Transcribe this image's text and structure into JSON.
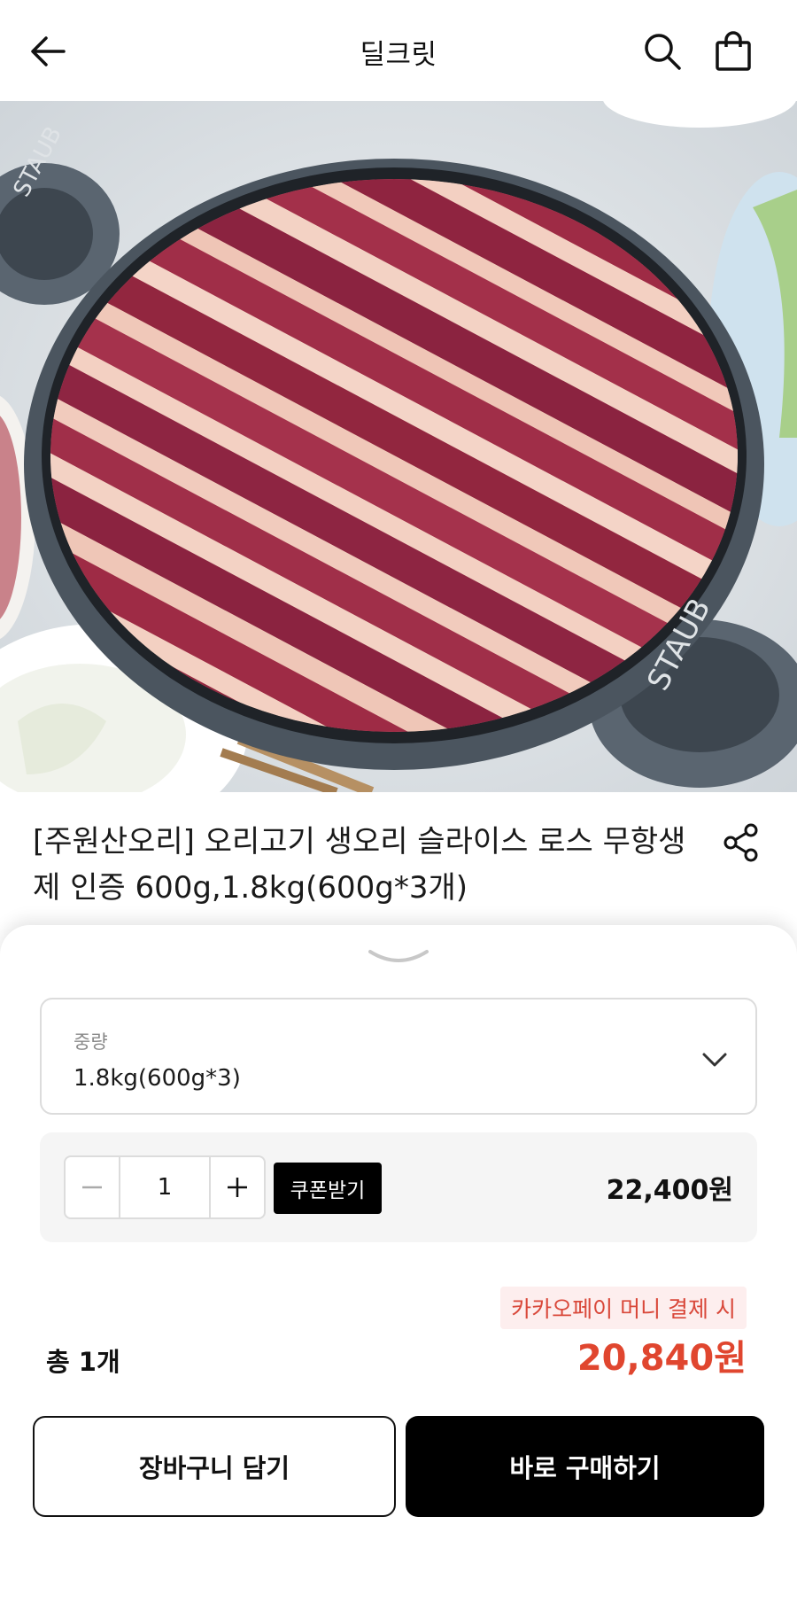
{
  "header": {
    "title": "딜크릿",
    "icons": [
      "back-arrow-icon",
      "search-icon",
      "shopping-bag-icon"
    ]
  },
  "hero": {
    "pan_lettering": "STAUB"
  },
  "product": {
    "title": "[주원산오리] 오리고기 생오리 슬라이스 로스 무항생제 인증 600g,1.8kg(600g*3개)",
    "share_icon": "share-icon"
  },
  "sheet": {
    "option": {
      "label": "중량",
      "value": "1.8kg(600g*3)"
    },
    "quantity": {
      "value": "1",
      "coupon_label": "쿠폰받기",
      "line_price": "22,400원"
    },
    "payment_badge": "카카오페이 머니 결제 시",
    "total_count": "총 1개",
    "total_price": "20,840원",
    "cart_button": "장바구니 담기",
    "buy_button": "바로 구매하기"
  },
  "colors": {
    "accent_red": "#e0462f",
    "badge_background": "#fdeeee",
    "primary_black": "#000000"
  }
}
